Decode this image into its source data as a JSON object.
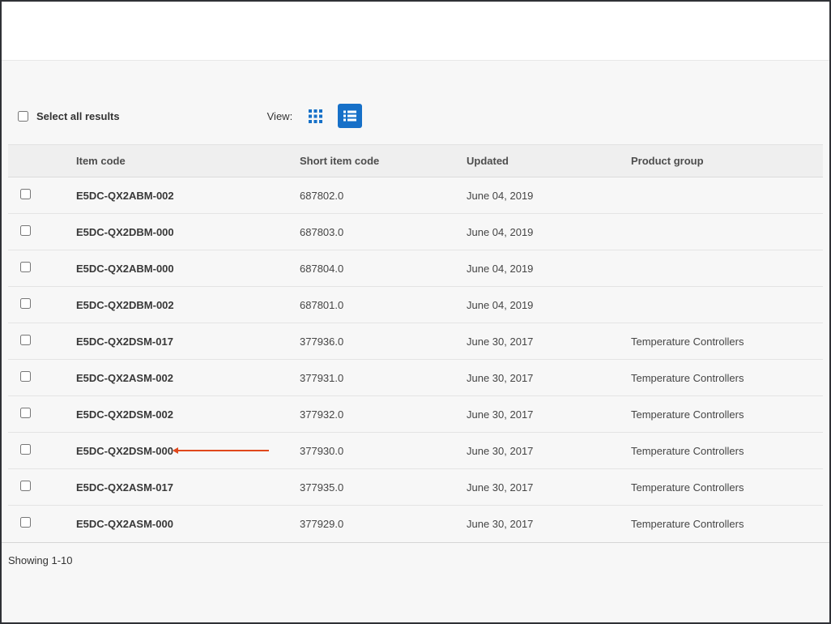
{
  "controls": {
    "select_all_label": "Select all results",
    "view_label": "View:"
  },
  "icons": {
    "grid_view": "grid-view-icon",
    "list_view": "list-view-icon"
  },
  "colors": {
    "accent": "#1670c8",
    "annotation": "#e0481c",
    "header_bg": "#efefef",
    "page_bg": "#f7f7f7"
  },
  "table": {
    "headers": [
      "Item code",
      "Short item code",
      "Updated",
      "Product group"
    ],
    "rows": [
      {
        "item_code": "E5DC-QX2ABM-002",
        "short_item_code": "687802.0",
        "updated": "June 04, 2019",
        "product_group": ""
      },
      {
        "item_code": "E5DC-QX2DBM-000",
        "short_item_code": "687803.0",
        "updated": "June 04, 2019",
        "product_group": ""
      },
      {
        "item_code": "E5DC-QX2ABM-000",
        "short_item_code": "687804.0",
        "updated": "June 04, 2019",
        "product_group": ""
      },
      {
        "item_code": "E5DC-QX2DBM-002",
        "short_item_code": "687801.0",
        "updated": "June 04, 2019",
        "product_group": ""
      },
      {
        "item_code": "E5DC-QX2DSM-017",
        "short_item_code": "377936.0",
        "updated": "June 30, 2017",
        "product_group": "Temperature Controllers"
      },
      {
        "item_code": "E5DC-QX2ASM-002",
        "short_item_code": "377931.0",
        "updated": "June 30, 2017",
        "product_group": "Temperature Controllers"
      },
      {
        "item_code": "E5DC-QX2DSM-002",
        "short_item_code": "377932.0",
        "updated": "June 30, 2017",
        "product_group": "Temperature Controllers"
      },
      {
        "item_code": "E5DC-QX2DSM-000",
        "short_item_code": "377930.0",
        "updated": "June 30, 2017",
        "product_group": "Temperature Controllers",
        "annotated": true
      },
      {
        "item_code": "E5DC-QX2ASM-017",
        "short_item_code": "377935.0",
        "updated": "June 30, 2017",
        "product_group": "Temperature Controllers"
      },
      {
        "item_code": "E5DC-QX2ASM-000",
        "short_item_code": "377929.0",
        "updated": "June 30, 2017",
        "product_group": "Temperature Controllers"
      }
    ]
  },
  "footer": {
    "showing": "Showing 1-10"
  }
}
